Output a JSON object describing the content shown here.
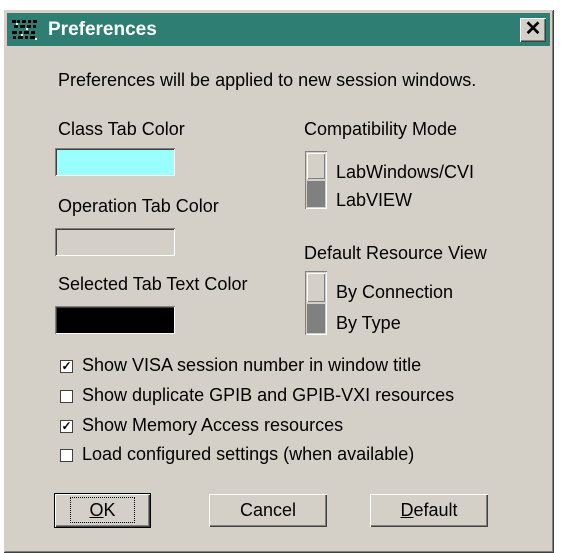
{
  "window": {
    "title": "Preferences",
    "close_glyph": "✕"
  },
  "intro": "Preferences will be applied to new session windows.",
  "colors": {
    "class_tab": {
      "label": "Class Tab Color",
      "value": "#99ffff"
    },
    "operation_tab": {
      "label": "Operation Tab Color",
      "value": "#d4d0c8"
    },
    "selected_text": {
      "label": "Selected Tab Text Color",
      "value": "#000000"
    }
  },
  "compat": {
    "label": "Compatibility Mode",
    "options": [
      "LabWindows/CVI",
      "LabVIEW"
    ],
    "selected": "LabVIEW"
  },
  "resource_view": {
    "label": "Default Resource View",
    "options": [
      "By Connection",
      "By Type"
    ],
    "selected": "By Type"
  },
  "checkboxes": [
    {
      "label": "Show VISA session number in window title",
      "checked": true
    },
    {
      "label": "Show duplicate GPIB and GPIB-VXI resources",
      "checked": false
    },
    {
      "label": "Show Memory Access resources",
      "checked": true
    },
    {
      "label": "Load configured settings (when available)",
      "checked": false
    }
  ],
  "buttons": {
    "ok": {
      "mnemonic": "O",
      "rest": "K"
    },
    "cancel": "Cancel",
    "default": {
      "mnemonic": "D",
      "rest": "efault"
    }
  }
}
